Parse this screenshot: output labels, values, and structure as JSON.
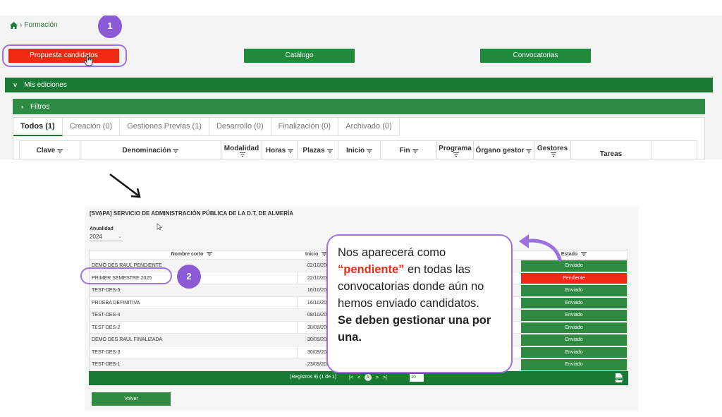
{
  "breadcrumb": {
    "current": "Formación",
    "icon": "home-icon"
  },
  "top_buttons": {
    "propuesta": "Propuesta candidatos",
    "catalogo": "Catálogo",
    "convocatorias": "Convocatorias"
  },
  "badges": {
    "first": "1",
    "second": "2"
  },
  "sections": {
    "mis_ediciones": "Mis ediciones",
    "filtros": "Filtros"
  },
  "tabs": [
    {
      "label": "Todos (1)"
    },
    {
      "label": "Creación (0)"
    },
    {
      "label": "Gestiones Previas (1)"
    },
    {
      "label": "Desarrollo (0)"
    },
    {
      "label": "Finalización (0)"
    },
    {
      "label": "Archivado (0)"
    }
  ],
  "main_table_headers": {
    "clave": "Clave",
    "denominacion": "Denominación",
    "modalidad": "Modalidad",
    "horas": "Horas",
    "plazas": "Plazas",
    "inicio": "Inicio",
    "fin": "Fin",
    "programa": "Programa",
    "organo": "Órgano gestor",
    "gestores": "Gestores",
    "tareas": "Tareas"
  },
  "detail": {
    "service": "[SVAPA] SERVICIO DE ADMINISTRACIÓN PÚBLICA DE LA D.T. DE ALMERÍA",
    "anualidad_label": "Anualidad",
    "anualidad_value": "2024",
    "headers": {
      "nombre": "Nombre corto",
      "inicio": "Inicio",
      "estado": "Estado"
    },
    "rows": [
      {
        "name": "DEMO DES RAUL PENDIENTE",
        "inicio": "02/10/202",
        "estado": "Enviado"
      },
      {
        "name": "PRIMER SEMESTRE 2025",
        "inicio": "22/10/202",
        "estado": "Pendiente"
      },
      {
        "name": "TEST-DES-5",
        "inicio": "16/10/202",
        "estado": "Enviado"
      },
      {
        "name": "PRUEBA DEFINITIVA",
        "inicio": "16/10/202",
        "estado": "Enviado"
      },
      {
        "name": "TEST-DES-4",
        "inicio": "08/10/202",
        "estado": "Enviado"
      },
      {
        "name": "TEST-DES-2",
        "inicio": "30/09/202",
        "estado": "Enviado"
      },
      {
        "name": "DEMO DES RAUL FINALIZADA",
        "inicio": "30/09/202",
        "estado": "Enviado"
      },
      {
        "name": "TEST-DES-3",
        "inicio": "30/09/202",
        "estado": "Enviado"
      },
      {
        "name": "TEST-DES-1",
        "inicio": "23/09/202",
        "estado": "Enviado"
      }
    ],
    "footer": {
      "registros": "(Registros 9) (1 de 1)",
      "first": "|<",
      "prev": "<",
      "page": "1",
      "next": ">",
      "last": ">|",
      "page_size": "10"
    },
    "volver": "Volver"
  },
  "callout": {
    "line1": "Nos aparecerá como",
    "highlight": "“pendiente”",
    "line2": " en todas las convocatorias donde aún no hemos enviado candidatos.",
    "bold": "Se deben gestionar una por una."
  },
  "colors": {
    "green": "#1a7a35",
    "red": "#ee2a12",
    "purple": "#9d72e0",
    "badge": "#8a5ad6"
  }
}
